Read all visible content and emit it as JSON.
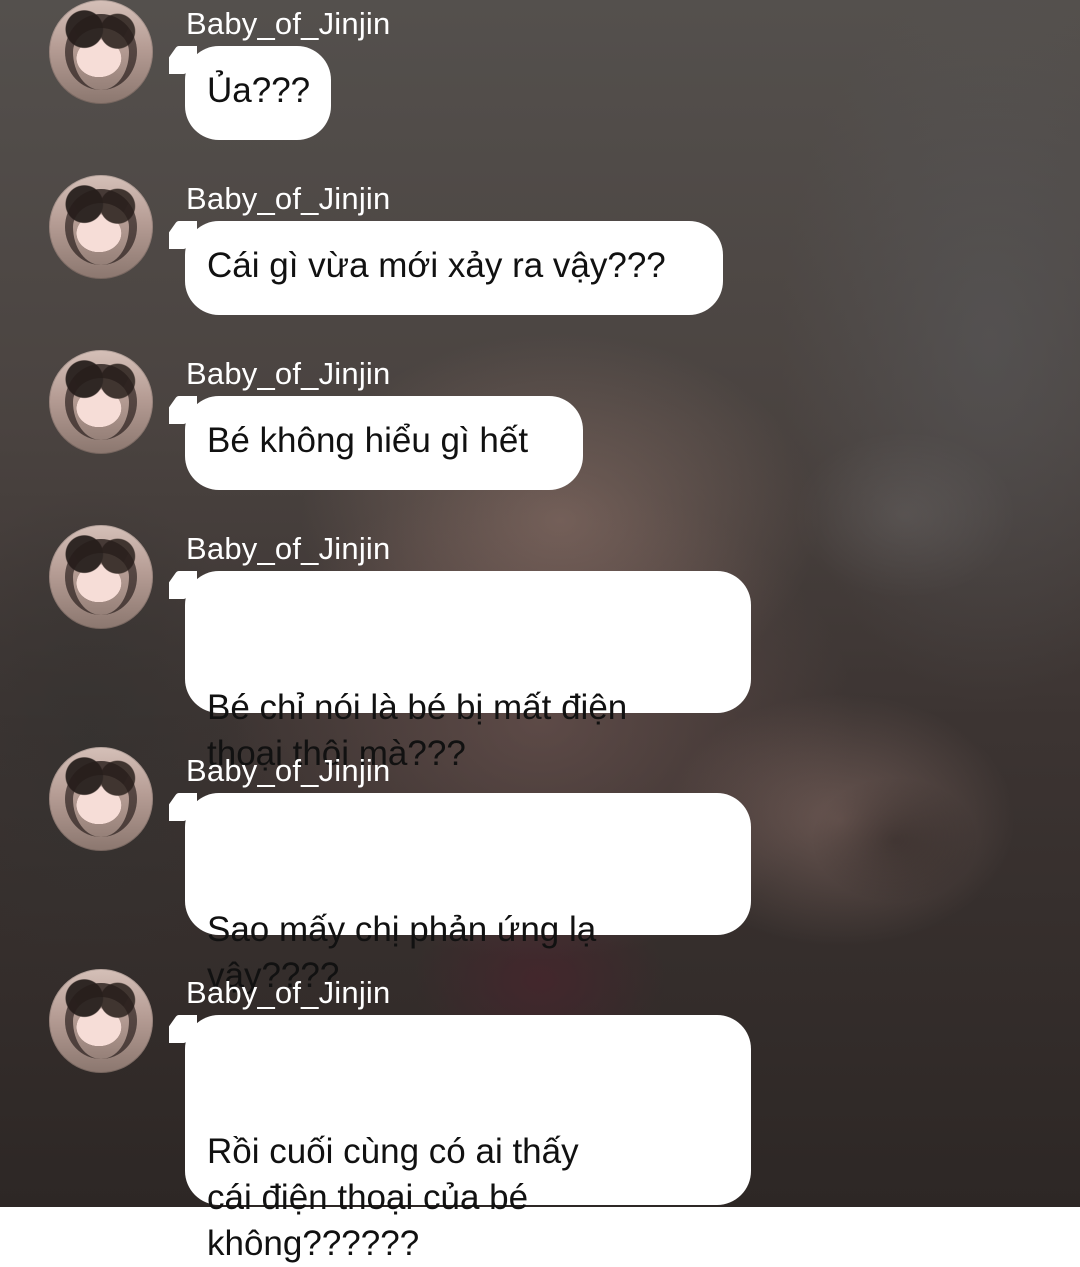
{
  "messages": [
    {
      "sender": "Baby_of_Jinjin",
      "text": "Ủa???",
      "avatar_icon": "user-avatar-icon"
    },
    {
      "sender": "Baby_of_Jinjin",
      "text": "Cái gì vừa mới xảy ra vậy???",
      "avatar_icon": "user-avatar-icon"
    },
    {
      "sender": "Baby_of_Jinjin",
      "text": "Bé không hiểu gì hết",
      "avatar_icon": "user-avatar-icon"
    },
    {
      "sender": "Baby_of_Jinjin",
      "text": "Bé chỉ nói là bé bị mất điện\nthoại thôi mà???",
      "avatar_icon": "user-avatar-icon"
    },
    {
      "sender": "Baby_of_Jinjin",
      "text": "Sao mấy chị phản ứng lạ\nvậy????",
      "avatar_icon": "user-avatar-icon"
    },
    {
      "sender": "Baby_of_Jinjin",
      "text": "Rồi cuối cùng có ai thấy\ncái điện thoại của bé\nkhông??????",
      "avatar_icon": "user-avatar-icon"
    }
  ],
  "colors": {
    "bubble": "#ffffff",
    "sender_text": "#ffffff",
    "message_text": "#111111"
  }
}
